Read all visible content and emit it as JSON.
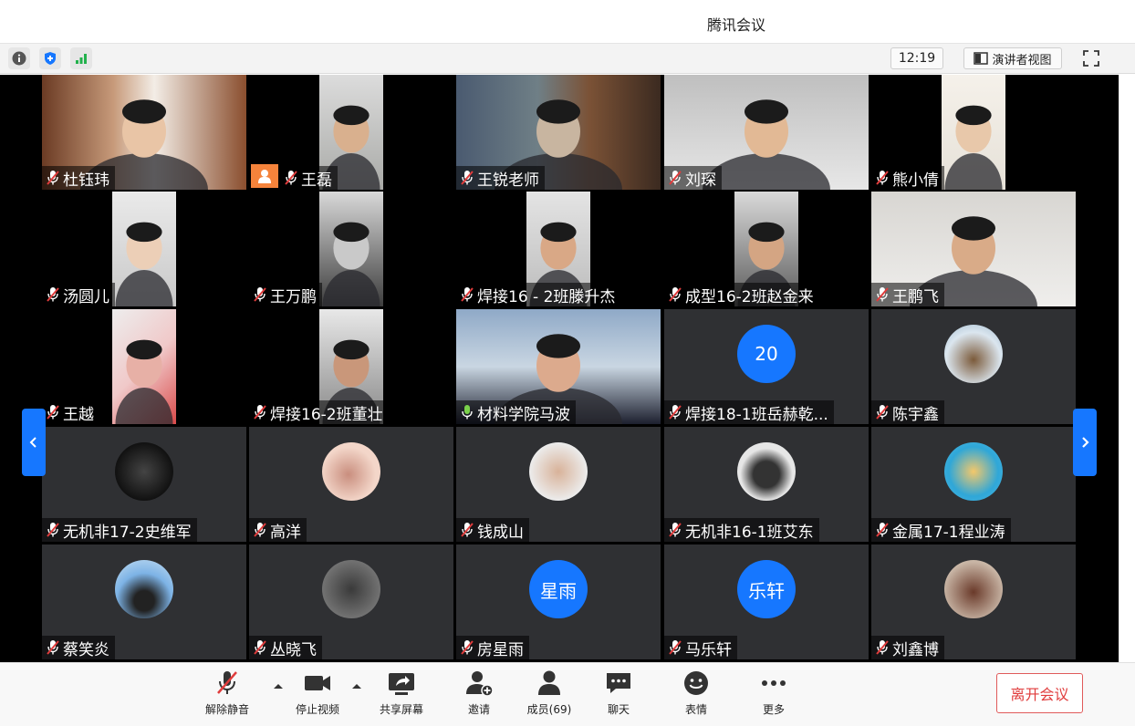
{
  "window": {
    "title": "腾讯会议"
  },
  "infobar": {
    "clock": "12:19",
    "speaker_view_label": "演讲者视图"
  },
  "colors": {
    "accent": "#1677ff",
    "leave": "#e03c3c",
    "active_speaker": "#2fd47a",
    "tile_bg": "#2f3033"
  },
  "participants": [
    {
      "name": "杜钰玮",
      "mic": "muted",
      "kind": "camera"
    },
    {
      "name": "王磊",
      "mic": "muted",
      "kind": "camera",
      "badge": "person-icon"
    },
    {
      "name": "王锐老师",
      "mic": "muted",
      "kind": "camera"
    },
    {
      "name": "刘琛",
      "mic": "muted",
      "kind": "camera"
    },
    {
      "name": "熊小倩",
      "mic": "muted",
      "kind": "camera"
    },
    {
      "name": "汤圆儿",
      "mic": "muted",
      "kind": "camera"
    },
    {
      "name": "王万鹏",
      "mic": "muted",
      "kind": "camera"
    },
    {
      "name": "焊接16 - 2班滕升杰",
      "mic": "muted",
      "kind": "camera"
    },
    {
      "name": "成型16-2班赵金来",
      "mic": "muted",
      "kind": "camera"
    },
    {
      "name": "王鹏飞",
      "mic": "muted",
      "kind": "camera"
    },
    {
      "name": "王越",
      "mic": "muted",
      "kind": "camera"
    },
    {
      "name": "焊接16-2班董壮",
      "mic": "muted",
      "kind": "camera"
    },
    {
      "name": "材料学院马波",
      "mic": "on",
      "kind": "camera",
      "active": true
    },
    {
      "name": "焊接18-1班岳赫乾...",
      "mic": "muted",
      "kind": "avatar",
      "avatar_text": "20"
    },
    {
      "name": "陈宇鑫",
      "mic": "muted",
      "kind": "avatar"
    },
    {
      "name": "无机非17-2史维军",
      "mic": "muted",
      "kind": "avatar"
    },
    {
      "name": "高洋",
      "mic": "muted",
      "kind": "avatar"
    },
    {
      "name": "钱成山",
      "mic": "muted",
      "kind": "avatar"
    },
    {
      "name": "无机非16-1班艾东",
      "mic": "muted",
      "kind": "avatar"
    },
    {
      "name": "金属17-1程业涛",
      "mic": "muted",
      "kind": "avatar"
    },
    {
      "name": "蔡笑炎",
      "mic": "muted",
      "kind": "avatar"
    },
    {
      "name": "丛晓飞",
      "mic": "muted",
      "kind": "avatar"
    },
    {
      "name": "房星雨",
      "mic": "muted",
      "kind": "avatar",
      "avatar_text": "星雨"
    },
    {
      "name": "马乐轩",
      "mic": "muted",
      "kind": "avatar",
      "avatar_text": "乐轩"
    },
    {
      "name": "刘鑫博",
      "mic": "muted",
      "kind": "avatar"
    }
  ],
  "toolbar": {
    "unmute": "解除静音",
    "stop_video": "停止视频",
    "share_screen": "共享屏幕",
    "invite": "邀请",
    "members": "成员(69)",
    "chat": "聊天",
    "emoji": "表情",
    "more": "更多",
    "leave": "离开会议"
  }
}
